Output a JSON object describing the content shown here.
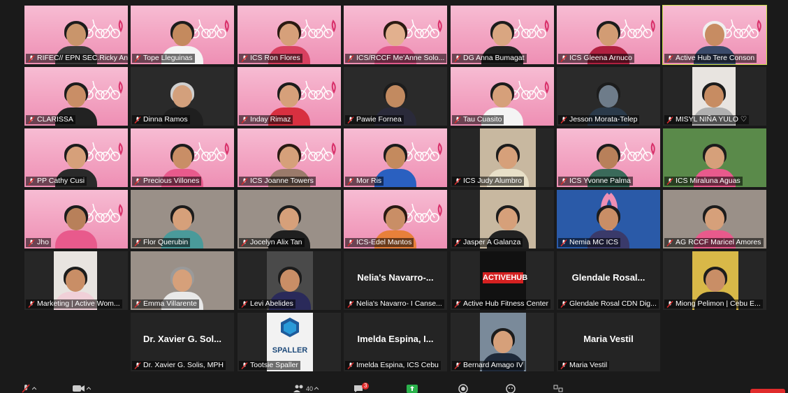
{
  "meeting": {
    "participants_count": "40",
    "chat_unread": "3"
  },
  "tiles": [
    {
      "name": "RIFEC// EPN SEC.Ricky An...",
      "bg": "pink",
      "skin": "#c9956b",
      "shirt": "#3a3a3a",
      "hair": "#1c1c1c"
    },
    {
      "name": "Tope Lleguinas",
      "bg": "pink",
      "skin": "#c48a5e",
      "shirt": "#f4f4f4",
      "hair": "#1c1c1c"
    },
    {
      "name": "ICS Ron Flores",
      "bg": "pink",
      "skin": "#d6a07a",
      "shirt": "#d84060",
      "hair": "#2a1a12"
    },
    {
      "name": "ICS/RCCF Me'Anne Solo...",
      "bg": "pink",
      "skin": "#e2b08e",
      "shirt": "#e05a8c",
      "hair": "#2a1a12"
    },
    {
      "name": "DG Anna Bumagat",
      "bg": "pink",
      "skin": "#d9a681",
      "shirt": "#222222",
      "hair": "#1c1c1c"
    },
    {
      "name": "ICS Gleena Arnuco",
      "bg": "pink",
      "skin": "#d29c74",
      "shirt": "#b02040",
      "hair": "#1c1c1c"
    },
    {
      "name": "Active Hub Tere Conson",
      "bg": "pink",
      "skin": "#c78c62",
      "shirt": "#3a4a6a",
      "hair": "#f0f0f0"
    },
    {
      "name": "CLARISSA",
      "bg": "pink",
      "skin": "#c98e66",
      "shirt": "#222222",
      "hair": "#1c1c1c"
    },
    {
      "name": "Dinna Ramos",
      "bg": "dark",
      "skin": "#d3a07c",
      "shirt": "#1f1f1f",
      "hair": "#cfcfcf"
    },
    {
      "name": "Inday Rimaz",
      "bg": "pink",
      "skin": "#d6a07a",
      "shirt": "#d83040",
      "hair": "#1c1c1c"
    },
    {
      "name": "Pawie Fornea",
      "bg": "dark",
      "skin": "#c28a60",
      "shirt": "#2a2a3a",
      "hair": "#1c1c1c"
    },
    {
      "name": "Tau Cuasito",
      "bg": "pink",
      "skin": "#d6a07a",
      "shirt": "#f4f4f4",
      "hair": "#1c1c1c"
    },
    {
      "name": "Jesson Morata-Telep",
      "bg": "dark",
      "skin": "#6e7c8a",
      "shirt": "#2a3a4a",
      "hair": "#1c1c1c"
    },
    {
      "name": "MISYL NIÑA YULO ♡",
      "bg": "light",
      "skin": "#c78c62",
      "shirt": "#b0b0b0",
      "hair": "#1c1c1c"
    },
    {
      "name": "PP Cathy Cusi",
      "bg": "pink",
      "skin": "#d6a07a",
      "shirt": "#2a2a2a",
      "hair": "#1c1c1c"
    },
    {
      "name": "Precious Villones",
      "bg": "pink",
      "skin": "#c98e66",
      "shirt": "#e85a8c",
      "hair": "#1c1c1c"
    },
    {
      "name": "ICS Joanne Towers",
      "bg": "pink",
      "skin": "#d6a07a",
      "shirt": "#9a7a6a",
      "hair": "#2a1a12"
    },
    {
      "name": "Mor Ris",
      "bg": "pink",
      "skin": "#c48a5e",
      "shirt": "#2a60c0",
      "hair": "#1c1c1c"
    },
    {
      "name": "ICS Judy Alumbro",
      "bg": "office",
      "skin": "#d6a07a",
      "shirt": "#e8e0c8",
      "hair": "#1c1c1c"
    },
    {
      "name": "ICS Yvonne Palma",
      "bg": "pink",
      "skin": "#b8805a",
      "shirt": "#3a6a5a",
      "hair": "#1c1c1c"
    },
    {
      "name": "ICS Miraluna Aguas",
      "bg": "green",
      "skin": "#d6a07a",
      "shirt": "#e85a8c",
      "hair": "#1c1c1c"
    },
    {
      "name": "Jho",
      "bg": "pink",
      "skin": "#b8805a",
      "shirt": "#e85a8c",
      "hair": "#1c1c1c"
    },
    {
      "name": "Flor Querubin",
      "bg": "room",
      "skin": "#d6a07a",
      "shirt": "#4a9a9a",
      "hair": "#1c1c1c"
    },
    {
      "name": "Jocelyn Alix Tan",
      "bg": "room",
      "skin": "#d6a07a",
      "shirt": "#1f1f1f",
      "hair": "#1c1c1c"
    },
    {
      "name": "ICS-Edel Mantos",
      "bg": "pink",
      "skin": "#c98e66",
      "shirt": "#e8803a",
      "hair": "#2a1a12"
    },
    {
      "name": "Jasper A Galanza",
      "bg": "office",
      "skin": "#d6a07a",
      "shirt": "#222222",
      "hair": "#1c1c1c"
    },
    {
      "name": "Nemia MC ICS",
      "bg": "ribbon",
      "skin": "#c98e66",
      "shirt": "#3a3a6a",
      "hair": "#1c1c1c"
    },
    {
      "name": "AG RCCF Maricel  Amores",
      "bg": "room",
      "skin": "#d6a07a",
      "shirt": "#e85a8c",
      "hair": "#1c1c1c"
    },
    {
      "name": "Marketing | Active Wom...",
      "bg": "light",
      "skin": "#c98e66",
      "shirt": "#f0d0d8",
      "hair": "#1c1c1c"
    },
    {
      "name": "Emma Villarente",
      "bg": "room",
      "skin": "#d6a07a",
      "shirt": "#e8e8e8",
      "hair": "#9a9a9a"
    },
    {
      "name": "Levi Abelides",
      "bg": "photo",
      "skin": "#c98e66",
      "shirt": "#2a2a5a",
      "hair": "#1c1c1c"
    },
    {
      "name": "Nelia's Navarro- I Canse...",
      "bg": "text",
      "label": "Nelia's  Navarro-..."
    },
    {
      "name": "Active Hub Fitness Center",
      "bg": "logo",
      "logo": "ACTIVEHUB"
    },
    {
      "name": "Glendale Rosal CDN Dig...",
      "bg": "text",
      "label": "Glendale  Rosal..."
    },
    {
      "name": "Miong Pelimon | Cebu E...",
      "bg": "yellow",
      "skin": "#c98e66",
      "shirt": "#1f1f1f",
      "hair": "#1c1c1c"
    },
    {
      "name": "Dr. Xavier G. Solis, MPH",
      "bg": "text",
      "label": "Dr. Xavier G. Sol..."
    },
    {
      "name": "Tootsie Spaller",
      "bg": "spaller",
      "logo": "SPALLER"
    },
    {
      "name": "Imelda Espina, ICS Cebu",
      "bg": "text",
      "label": "Imelda  Espina,  I..."
    },
    {
      "name": "Bernard Amago IV",
      "bg": "portrait",
      "skin": "#d6a07a",
      "shirt": "#1f2a3a",
      "hair": "#1c1c1c"
    },
    {
      "name": "Maria Vestil",
      "bg": "text",
      "label": "Maria Vestil"
    }
  ],
  "colors": {
    "background": "#1a1a1a",
    "speaking_border": "#c8e04a",
    "mute_red": "#e02b2b",
    "accent_pink": "#ee8fb4"
  }
}
